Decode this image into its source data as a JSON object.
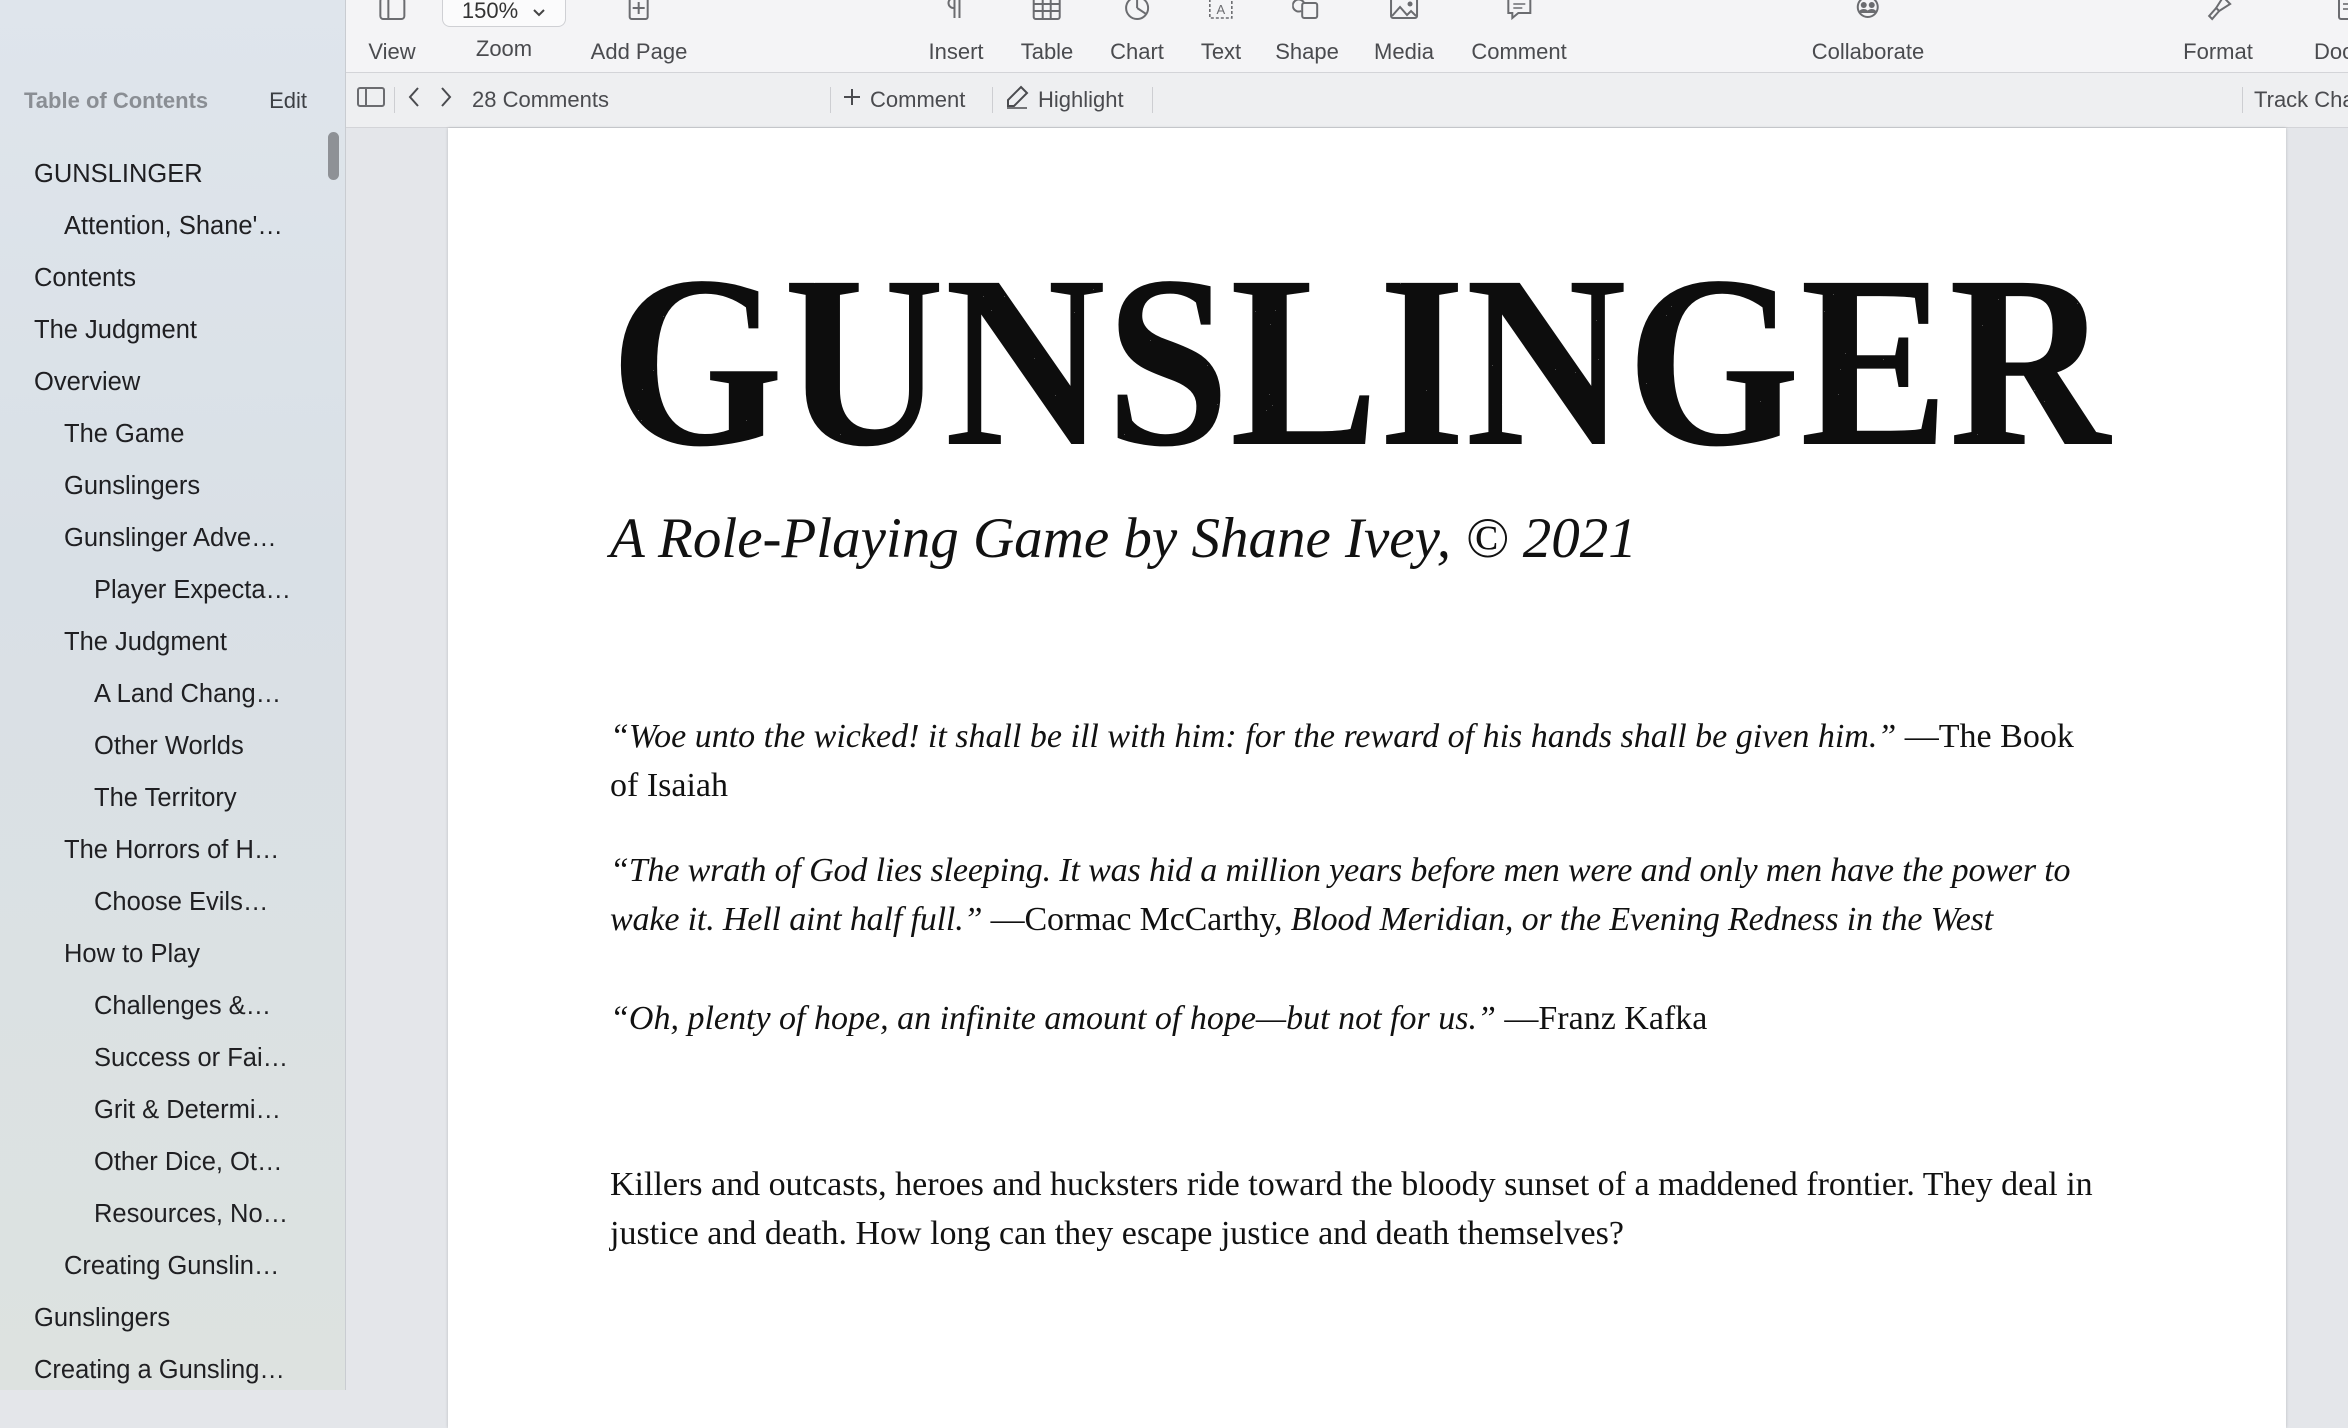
{
  "toolbar": {
    "view": "View",
    "zoom_value": "150%",
    "zoom": "Zoom",
    "add_page": "Add Page",
    "insert": "Insert",
    "table": "Table",
    "chart": "Chart",
    "text": "Text",
    "shape": "Shape",
    "media": "Media",
    "comment": "Comment",
    "collaborate": "Collaborate",
    "format": "Format",
    "document": "Docu"
  },
  "comment_bar": {
    "count": "28 Comments",
    "add_comment": "Comment",
    "highlight": "Highlight",
    "track_changes": "Track Cha"
  },
  "sidebar": {
    "title": "Table of Contents",
    "edit": "Edit",
    "items": [
      {
        "label": "GUNSLINGER",
        "level": 0
      },
      {
        "label": "Attention, Shane'…",
        "level": 1
      },
      {
        "label": "Contents",
        "level": 0
      },
      {
        "label": "The Judgment",
        "level": 0
      },
      {
        "label": "Overview",
        "level": 0
      },
      {
        "label": "The Game",
        "level": 1
      },
      {
        "label": "Gunslingers",
        "level": 1
      },
      {
        "label": "Gunslinger Adve…",
        "level": 1
      },
      {
        "label": "Player Expecta…",
        "level": 2
      },
      {
        "label": "The Judgment",
        "level": 1
      },
      {
        "label": "A Land Chang…",
        "level": 2
      },
      {
        "label": "Other Worlds",
        "level": 2
      },
      {
        "label": "The Territory",
        "level": 2
      },
      {
        "label": "The Horrors of H…",
        "level": 1
      },
      {
        "label": "Choose Evils…",
        "level": 2
      },
      {
        "label": "How to Play",
        "level": 1
      },
      {
        "label": "Challenges &…",
        "level": 2
      },
      {
        "label": "Success or Fai…",
        "level": 2
      },
      {
        "label": "Grit & Determi…",
        "level": 2
      },
      {
        "label": "Other Dice, Ot…",
        "level": 2
      },
      {
        "label": "Resources, No…",
        "level": 2
      },
      {
        "label": "Creating Gunslin…",
        "level": 1
      },
      {
        "label": "Gunslingers",
        "level": 0
      },
      {
        "label": "Creating a Gunsling…",
        "level": 0
      }
    ]
  },
  "document": {
    "title": "GUNSLINGER",
    "subtitle": "A Role-Playing Game by Shane Ivey, © 2021",
    "quotes": [
      {
        "quote": "“Woe unto the wicked! it shall be ill with him: for the reward of his hands shall be given him.”",
        "source_prefix": " —The Book of Isaiah",
        "source_title": "",
        "source_suffix": ""
      },
      {
        "quote": "“The wrath of God lies sleeping. It was hid a million years before men were and only men have the power to wake it. Hell aint half full.”",
        "source_prefix": " —Cormac McCarthy, ",
        "source_title": "Blood Meridian, or the Evening Redness in the West",
        "source_suffix": ""
      },
      {
        "quote": "“Oh, plenty of hope, an infinite amount of hope—but not for us.”",
        "source_prefix": " —Franz Kafka",
        "source_title": "",
        "source_suffix": ""
      }
    ],
    "body": "Killers and outcasts, heroes and hucksters ride toward the bloody sunset of a maddened frontier. They deal in justice and death. How long can they escape justice and death themselves?"
  },
  "colors": {
    "sidebar_bg": "#dde3e9",
    "toolbar_bg": "#f4f4f6",
    "canvas_bg": "#e4e6ea",
    "page_bg": "#ffffff",
    "text": "#111111"
  }
}
